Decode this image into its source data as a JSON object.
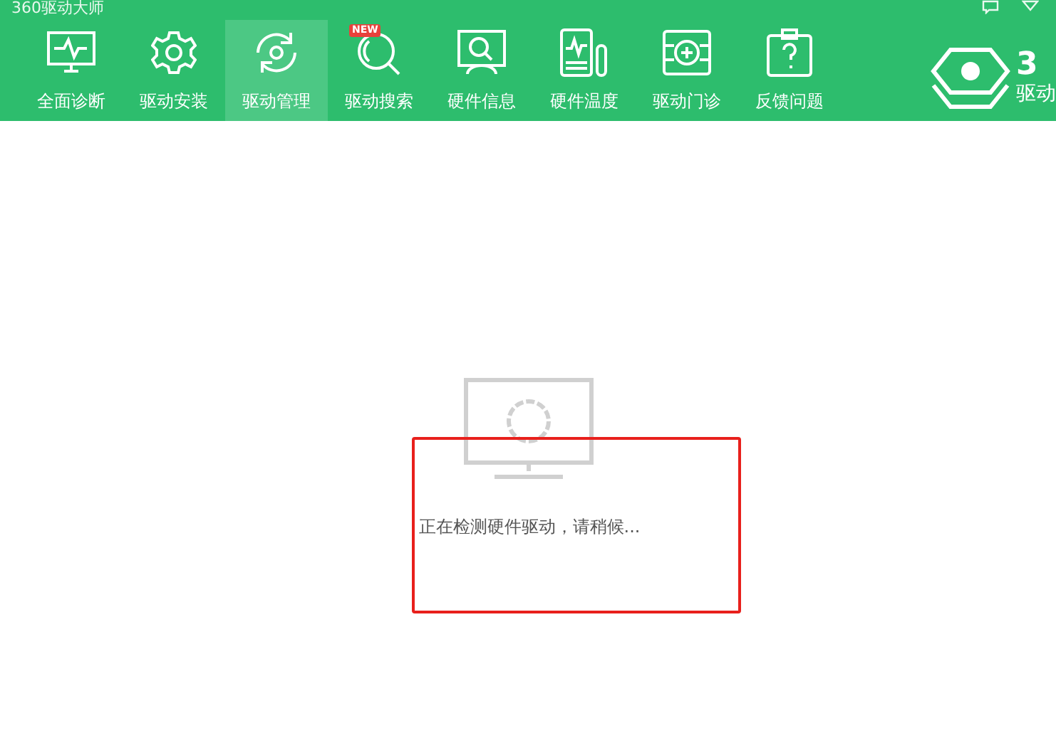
{
  "window": {
    "title": "360驱动大师"
  },
  "tabs": [
    {
      "label": "全面诊断",
      "selected": false
    },
    {
      "label": "驱动安装",
      "selected": false
    },
    {
      "label": "驱动管理",
      "selected": true
    },
    {
      "label": "驱动搜索",
      "selected": false,
      "badge": "NEW"
    },
    {
      "label": "硬件信息",
      "selected": false
    },
    {
      "label": "硬件温度",
      "selected": false
    },
    {
      "label": "驱动门诊",
      "selected": false
    },
    {
      "label": "反馈问题",
      "selected": false
    }
  ],
  "logo": {
    "number": "3",
    "name": "驱动"
  },
  "status": {
    "message": "正在检测硬件驱动，请稍候..."
  }
}
